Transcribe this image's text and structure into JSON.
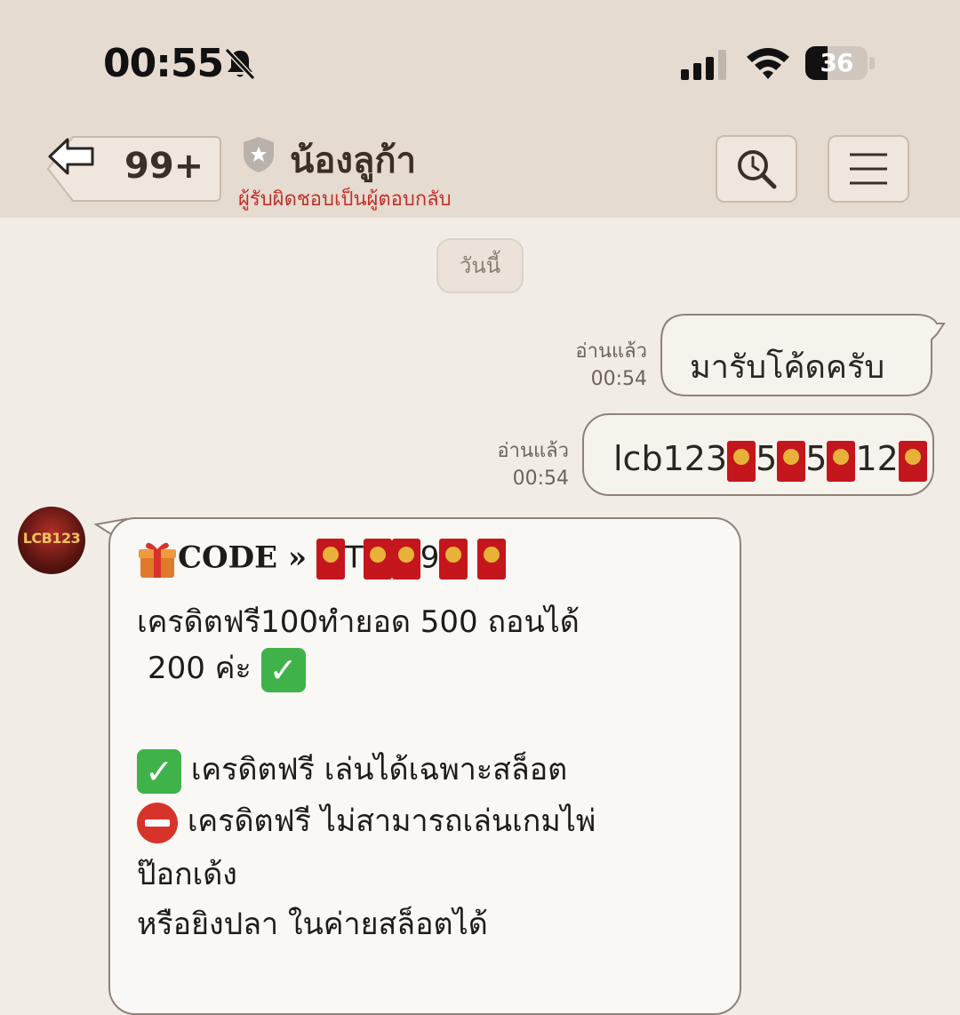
{
  "status_bar": {
    "time": "00:55",
    "battery": "36",
    "battery_level": 0.36
  },
  "nav": {
    "back_count": "99+",
    "title": "น้องลูก้า",
    "subtitle": "ผู้รับผิดชอบเป็นผู้ตอบกลับ"
  },
  "date_separator": "วันนี้",
  "outgoing": [
    {
      "read": "อ่านแล้ว",
      "time": "00:54",
      "text": "มารับโค้ดครับ"
    },
    {
      "read": "อ่านแล้ว",
      "time": "00:54",
      "text_prefix": "lcb123",
      "text_parts": [
        "5",
        "5",
        "12"
      ]
    }
  ],
  "avatar": {
    "label": "LCB123"
  },
  "incoming": {
    "code_label": "CODE »",
    "code_fragment_1": "T",
    "code_fragment_2": "9",
    "line_1": "เครดิตฟรี100ทำยอด 500 ถอนได้",
    "line_2": "200 ค่ะ",
    "line_3": "เครดิตฟรี เล่นได้เฉพาะสล็อต",
    "line_4": "เครดิตฟรี ไม่สามารถเล่นเกมไพ่",
    "line_5": "ป๊อกเด้ง",
    "line_6": "หรือยิงปลา ในค่ายสล็อตได้"
  },
  "colors": {
    "header": "#e6dbd0",
    "background": "#f1ede6",
    "subtitle": "#c0302b",
    "envelope": "#c4161c"
  }
}
